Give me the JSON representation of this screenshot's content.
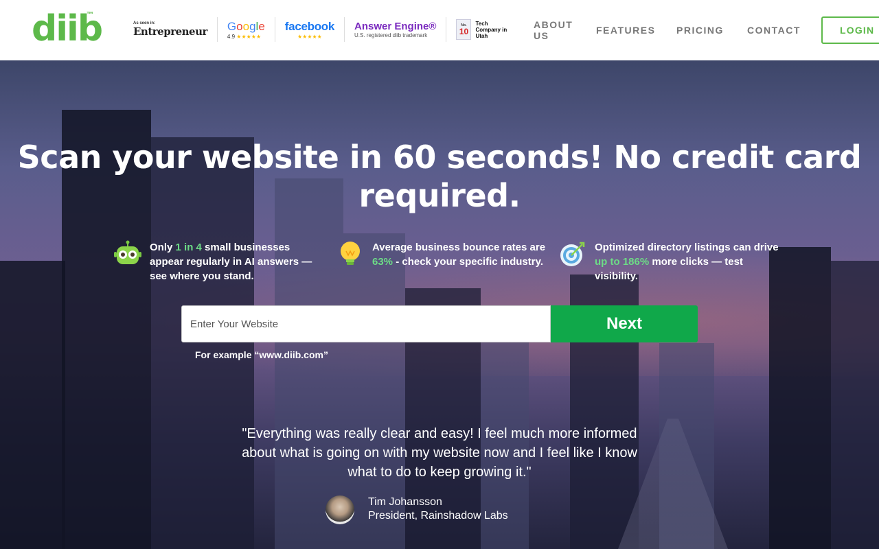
{
  "header": {
    "logo_text": "diib",
    "logo_tm": "™",
    "badges": {
      "entrepreneur_small": "As seen in:",
      "entrepreneur_name": "Entrepreneur",
      "google_rating": "4.9",
      "google_stars": "★★★★★",
      "facebook_name": "facebook",
      "facebook_stars": "★★★★★",
      "answer_engine_name": "Answer Engine®",
      "answer_engine_sub": "U.S. registered diib trademark",
      "tech_no": "No.",
      "tech_num": "10",
      "tech_label": "Tech Company in Utah"
    },
    "nav": {
      "about": "ABOUT US",
      "features": "FEATURES",
      "pricing": "PRICING",
      "contact": "CONTACT",
      "login": "LOGIN"
    },
    "colors": {
      "brand": "#5db94a"
    }
  },
  "hero": {
    "title": "Scan your website in 60 seconds! No credit card required.",
    "features": [
      {
        "icon": "robot-icon",
        "pre": "Only ",
        "highlight": "1 in 4",
        "post": " small businesses appear regularly in AI answers — see where you stand."
      },
      {
        "icon": "lightbulb-icon",
        "pre": "Average business bounce rates are ",
        "highlight": "63%",
        "post": " - check your specific industry."
      },
      {
        "icon": "target-icon",
        "pre": "Optimized directory listings can drive ",
        "highlight": "up to 186%",
        "post": " more clicks — test visibility."
      }
    ],
    "input_placeholder": "Enter Your Website",
    "next_label": "Next",
    "example": "For example “www.diib.com”",
    "quote": "\"Everything was really clear and easy! I feel much more informed about what is going on with my website now and I feel like I know what to do to keep growing it.\"",
    "person_name": "Tim Johansson",
    "person_title": "President, Rainshadow Labs",
    "colors": {
      "highlight": "#6ddc86",
      "cta": "#10a84a"
    }
  }
}
